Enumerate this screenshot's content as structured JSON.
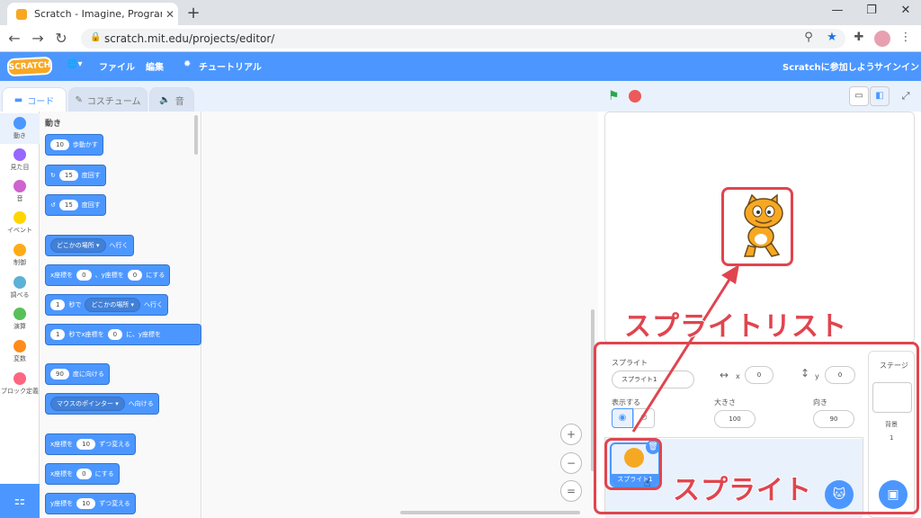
{
  "browser": {
    "tab_title": "Scratch - Imagine, Program, Shar",
    "tab_close": "✕",
    "new_tab": "+",
    "url": "scratch.mit.edu/projects/editor/",
    "window_controls": [
      "—",
      "❐",
      "✕"
    ]
  },
  "menu": {
    "logo": "SCRATCH",
    "globe": "🌐▾",
    "file": "ファイル",
    "edit": "編集",
    "tutorial": "チュートリアル",
    "join": "Scratchに参加しよう",
    "signin": "サインイン"
  },
  "tabs": {
    "code": "コード",
    "costumes": "コスチューム",
    "sounds": "音"
  },
  "categories": [
    {
      "label": "動き",
      "color": "#4c97ff"
    },
    {
      "label": "見た目",
      "color": "#9966ff"
    },
    {
      "label": "音",
      "color": "#cf63cf"
    },
    {
      "label": "イベント",
      "color": "#ffd500"
    },
    {
      "label": "制御",
      "color": "#ffab19"
    },
    {
      "label": "調べる",
      "color": "#5cb1d6"
    },
    {
      "label": "演算",
      "color": "#59c059"
    },
    {
      "label": "変数",
      "color": "#ff8c1a"
    },
    {
      "label": "ブロック定義",
      "color": "#ff6680"
    }
  ],
  "palette": {
    "section_title": "動き",
    "move_steps": "歩動かす",
    "move_val": "10",
    "turn_right": "度回す",
    "turn_right_val": "15",
    "turn_left": "度回す",
    "turn_left_val": "15",
    "goto_dd": "どこかの場所 ▾",
    "goto_suffix": "へ行く",
    "xy_prefix": "x座標を",
    "xy_x": "0",
    "xy_mid": "、y座標を",
    "xy_y": "0",
    "xy_suffix": "にする",
    "glide_val": "1",
    "glide_mid": "秒で",
    "glide_dd": "どこかの場所 ▾",
    "glide_suffix": "へ行く",
    "glide2_val": "1",
    "glide2_mid": "秒でx座標を",
    "glide2_x": "0",
    "glide2_mid2": "に、y座標を",
    "point_val": "90",
    "point_suffix": "度に向ける",
    "pointto_dd": "マウスのポインター ▾",
    "pointto_suffix": "へ向ける",
    "changex_prefix": "x座標を",
    "changex_val": "10",
    "changex_suffix": "ずつ変える",
    "setx_prefix": "x座標を",
    "setx_val": "0",
    "setx_suffix": "にする",
    "changey_prefix": "y座標を",
    "changey_val": "10",
    "changey_suffix": "ずつ変える"
  },
  "sprite_info": {
    "sprite_label": "スプライト",
    "sprite_name": "スプライト1",
    "x_label": "x",
    "x_value": "0",
    "y_label": "y",
    "y_value": "0",
    "show_label": "表示する",
    "size_label": "大きさ",
    "size_value": "100",
    "direction_label": "向き",
    "direction_value": "90"
  },
  "sprite_list": {
    "thumb_label": "スプライト1"
  },
  "stage_pane": {
    "title": "ステージ",
    "backdrops_label": "背景",
    "backdrops_count": "1"
  },
  "annotations": {
    "sprite_list": "スプライトリスト",
    "sprite": "スプライト"
  },
  "colors": {
    "scratch_blue": "#4c97ff",
    "annotation_red": "#e0454f"
  }
}
